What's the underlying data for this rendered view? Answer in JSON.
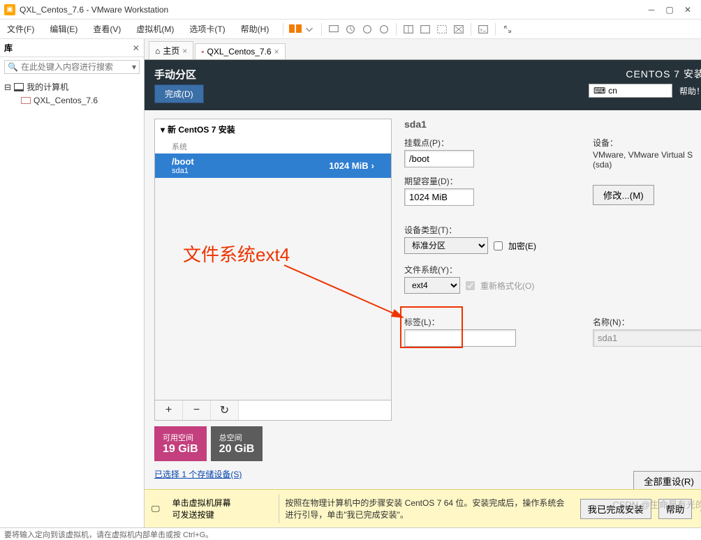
{
  "window": {
    "title": "QXL_Centos_7.6 - VMware Workstation"
  },
  "menu": {
    "file": "文件(F)",
    "edit": "编辑(E)",
    "view": "查看(V)",
    "vm": "虚拟机(M)",
    "tabs": "选项卡(T)",
    "help": "帮助(H)"
  },
  "sidebar": {
    "header": "库",
    "search_placeholder": "在此处键入内容进行搜索",
    "root": "我的计算机",
    "child": "QXL_Centos_7.6"
  },
  "tabs": {
    "home": "主页",
    "vm": "QXL_Centos_7.6"
  },
  "installer": {
    "header_title": "手动分区",
    "done": "完成(D)",
    "os_name": "CENTOS 7 安装",
    "kb": "cn",
    "help": "帮助！",
    "partlist_title": "新 CentOS 7 安装",
    "partlist_subhead": "系统",
    "part": {
      "name": "/boot",
      "dev": "sda1",
      "size": "1024 MiB"
    },
    "annotation": "文件系统ext4",
    "avail_label": "可用空间",
    "avail_value": "19 GiB",
    "total_label": "总空间",
    "total_value": "20 GiB",
    "storage_link": "已选择 1 个存储设备(S)",
    "detail": {
      "dev": "sda1",
      "mountpoint_label": "挂载点(P)：",
      "mountpoint_value": "/boot",
      "device_label": "设备：",
      "device_value": "VMware, VMware Virtual S (sda)",
      "capacity_label": "期望容量(D)：",
      "capacity_value": "1024 MiB",
      "modify": "修改...(M)",
      "devtype_label": "设备类型(T)：",
      "devtype_value": "标准分区",
      "encrypt": "加密(E)",
      "fs_label": "文件系统(Y)：",
      "fs_value": "ext4",
      "reformat": "重新格式化(O)",
      "tag_label": "标签(L)：",
      "name_label": "名称(N)：",
      "name_value": "sda1"
    },
    "reset_all": "全部重设(R)",
    "yellowbar_hint1": "单击虚拟机屏幕\n可发送按键",
    "yellowbar_hint2": "按照在物理计算机中的步骤安装 CentOS 7 64 位。安装完成后，操作系统会进行引导，单击\"我已完成安装\"。",
    "done_install": "我已完成安装",
    "help_btn": "帮助"
  },
  "statusbar": "要将输入定向到该虚拟机，请在虚拟机内部单击或按 Ctrl+G。",
  "watermark": "CSDN @生命是有光的"
}
